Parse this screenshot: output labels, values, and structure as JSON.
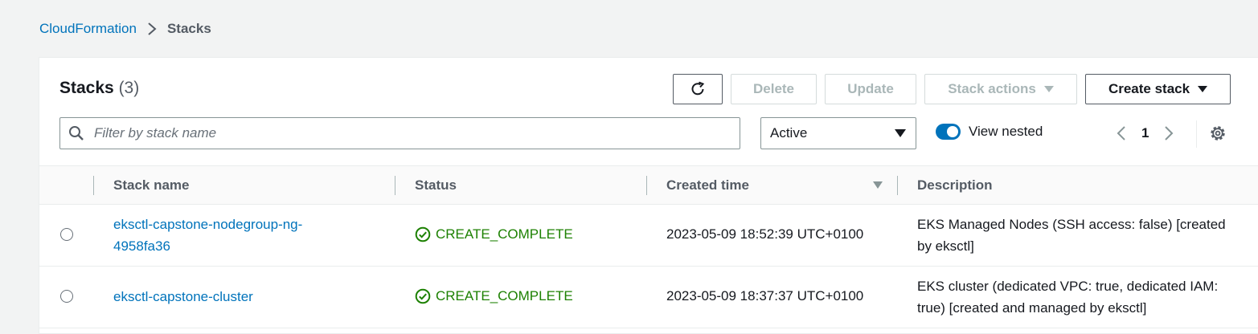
{
  "breadcrumb": {
    "root": "CloudFormation",
    "current": "Stacks"
  },
  "header": {
    "title": "Stacks",
    "count": "(3)",
    "delete_label": "Delete",
    "update_label": "Update",
    "stack_actions_label": "Stack actions",
    "create_stack_label": "Create stack"
  },
  "filter": {
    "placeholder": "Filter by stack name",
    "status_selected": "Active",
    "view_nested_label": "View nested",
    "view_nested_on": true
  },
  "pagination": {
    "current_page": "1"
  },
  "table": {
    "columns": [
      "Stack name",
      "Status",
      "Created time",
      "Description"
    ],
    "sorted_column": "Created time",
    "rows": [
      {
        "name": "eksctl-capstone-nodegroup-ng-4958fa36",
        "status": "CREATE_COMPLETE",
        "created": "2023-05-09 18:52:39 UTC+0100",
        "description": "EKS Managed Nodes (SSH access: false) [created by eksctl]"
      },
      {
        "name": "eksctl-capstone-cluster",
        "status": "CREATE_COMPLETE",
        "created": "2023-05-09 18:37:37 UTC+0100",
        "description": "EKS cluster (dedicated VPC: true, dedicated IAM: true) [created and managed by eksctl]"
      }
    ]
  },
  "icons": [
    "chevron-right-icon",
    "refresh-icon",
    "caret-down-icon",
    "search-icon",
    "chevron-left-icon",
    "gear-icon",
    "status-success-icon"
  ],
  "colors": {
    "link": "#0073bb",
    "success": "#1d8102",
    "toggle": "#0073bb",
    "background": "#f2f3f3"
  }
}
